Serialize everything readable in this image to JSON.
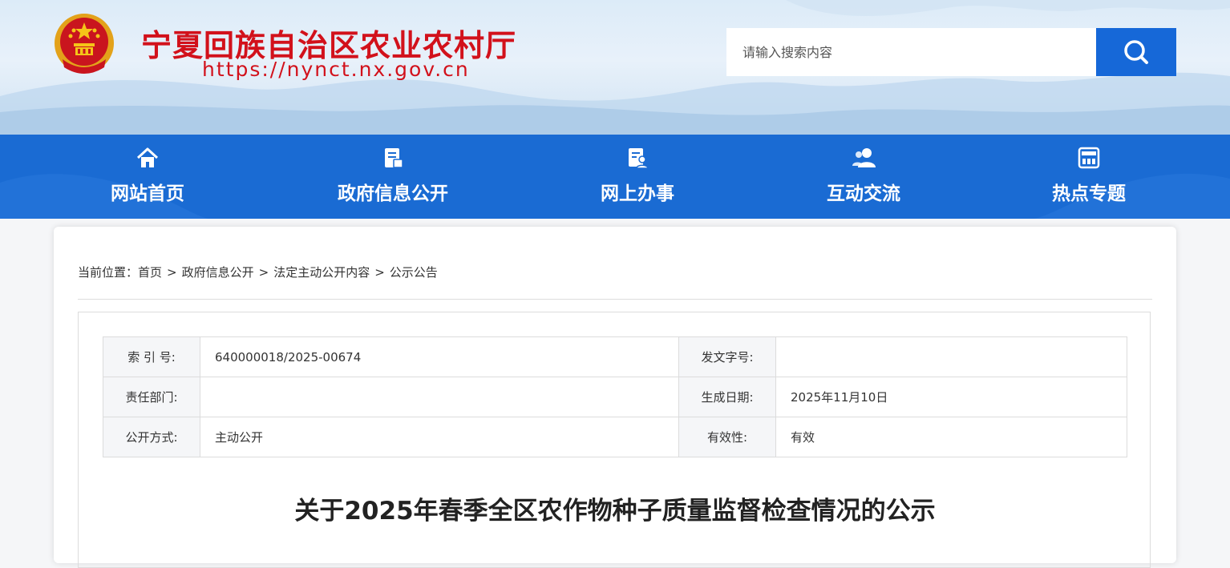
{
  "header": {
    "title": "宁夏回族自治区农业农村厅",
    "url": "https://nynct.nx.gov.cn",
    "search": {
      "placeholder": "请输入搜索内容",
      "button_icon": "search-icon"
    }
  },
  "nav": {
    "items": [
      {
        "label": "网站首页",
        "icon": "home-icon"
      },
      {
        "label": "政府信息公开",
        "icon": "document-icon"
      },
      {
        "label": "网上办事",
        "icon": "service-icon"
      },
      {
        "label": "互动交流",
        "icon": "users-icon"
      },
      {
        "label": "热点专题",
        "icon": "topic-icon"
      }
    ]
  },
  "breadcrumb": {
    "prefix": "当前位置：",
    "items": [
      "首页",
      "政府信息公开",
      "法定主动公开内容",
      "公示公告"
    ],
    "separator": ">"
  },
  "meta": {
    "rows": [
      {
        "label1": "索 引 号:",
        "value1": "640000018/2025-00674",
        "label2": "发文字号:",
        "value2": ""
      },
      {
        "label1": "责任部门:",
        "value1": "",
        "label2": "生成日期:",
        "value2": "2025年11月10日"
      },
      {
        "label1": "公开方式:",
        "value1": "主动公开",
        "label2": "有效性:",
        "value2": "有效"
      }
    ]
  },
  "article": {
    "title": "关于2025年春季全区农作物种子质量监督检查情况的公示"
  },
  "colors": {
    "brand_red": "#d2111b",
    "nav_blue": "#1a6bd3",
    "search_blue": "#1668d8"
  }
}
